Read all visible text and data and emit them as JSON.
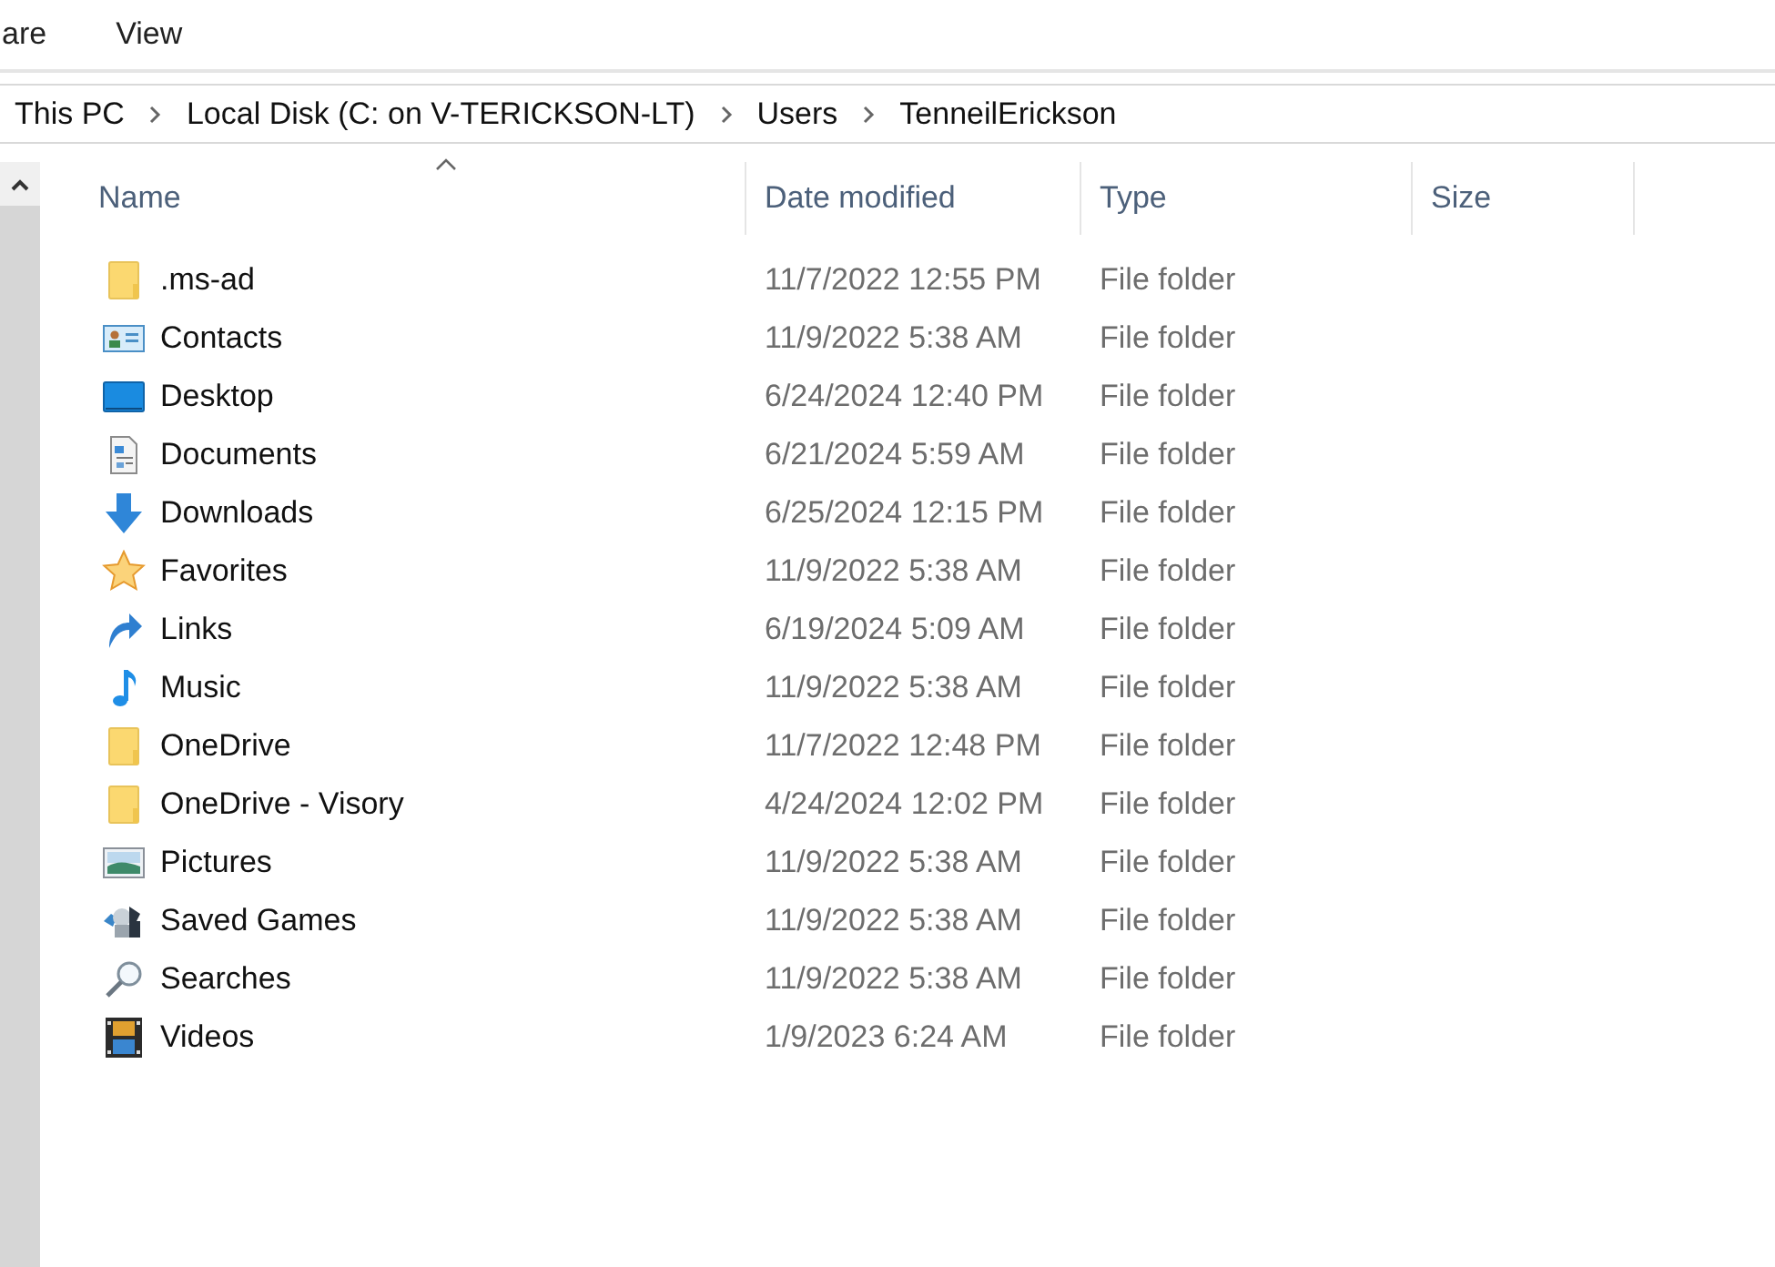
{
  "ribbon_tabs": [
    {
      "label": "are"
    },
    {
      "label": "View"
    }
  ],
  "breadcrumb": [
    "This PC",
    "Local Disk (C: on V-TERICKSON-LT)",
    "Users",
    "TenneilErickson"
  ],
  "columns": [
    "Name",
    "Date modified",
    "Type",
    "Size"
  ],
  "rows": [
    {
      "kind": "folder",
      "name": ".ms-ad",
      "date": "11/7/2022 12:55 PM",
      "type": "File folder"
    },
    {
      "kind": "contacts",
      "name": "Contacts",
      "date": "11/9/2022 5:38 AM",
      "type": "File folder"
    },
    {
      "kind": "desktop",
      "name": "Desktop",
      "date": "6/24/2024 12:40 PM",
      "type": "File folder"
    },
    {
      "kind": "documents",
      "name": "Documents",
      "date": "6/21/2024 5:59 AM",
      "type": "File folder"
    },
    {
      "kind": "downloads",
      "name": "Downloads",
      "date": "6/25/2024 12:15 PM",
      "type": "File folder"
    },
    {
      "kind": "favorites",
      "name": "Favorites",
      "date": "11/9/2022 5:38 AM",
      "type": "File folder"
    },
    {
      "kind": "links",
      "name": "Links",
      "date": "6/19/2024 5:09 AM",
      "type": "File folder"
    },
    {
      "kind": "music",
      "name": "Music",
      "date": "11/9/2022 5:38 AM",
      "type": "File folder"
    },
    {
      "kind": "folder",
      "name": "OneDrive",
      "date": "11/7/2022 12:48 PM",
      "type": "File folder"
    },
    {
      "kind": "folder",
      "name": "OneDrive - Visory",
      "date": "4/24/2024 12:02 PM",
      "type": "File folder"
    },
    {
      "kind": "pictures",
      "name": "Pictures",
      "date": "11/9/2022 5:38 AM",
      "type": "File folder"
    },
    {
      "kind": "games",
      "name": "Saved Games",
      "date": "11/9/2022 5:38 AM",
      "type": "File folder"
    },
    {
      "kind": "searches",
      "name": "Searches",
      "date": "11/9/2022 5:38 AM",
      "type": "File folder"
    },
    {
      "kind": "videos",
      "name": "Videos",
      "date": "1/9/2023 6:24 AM",
      "type": "File folder"
    }
  ]
}
